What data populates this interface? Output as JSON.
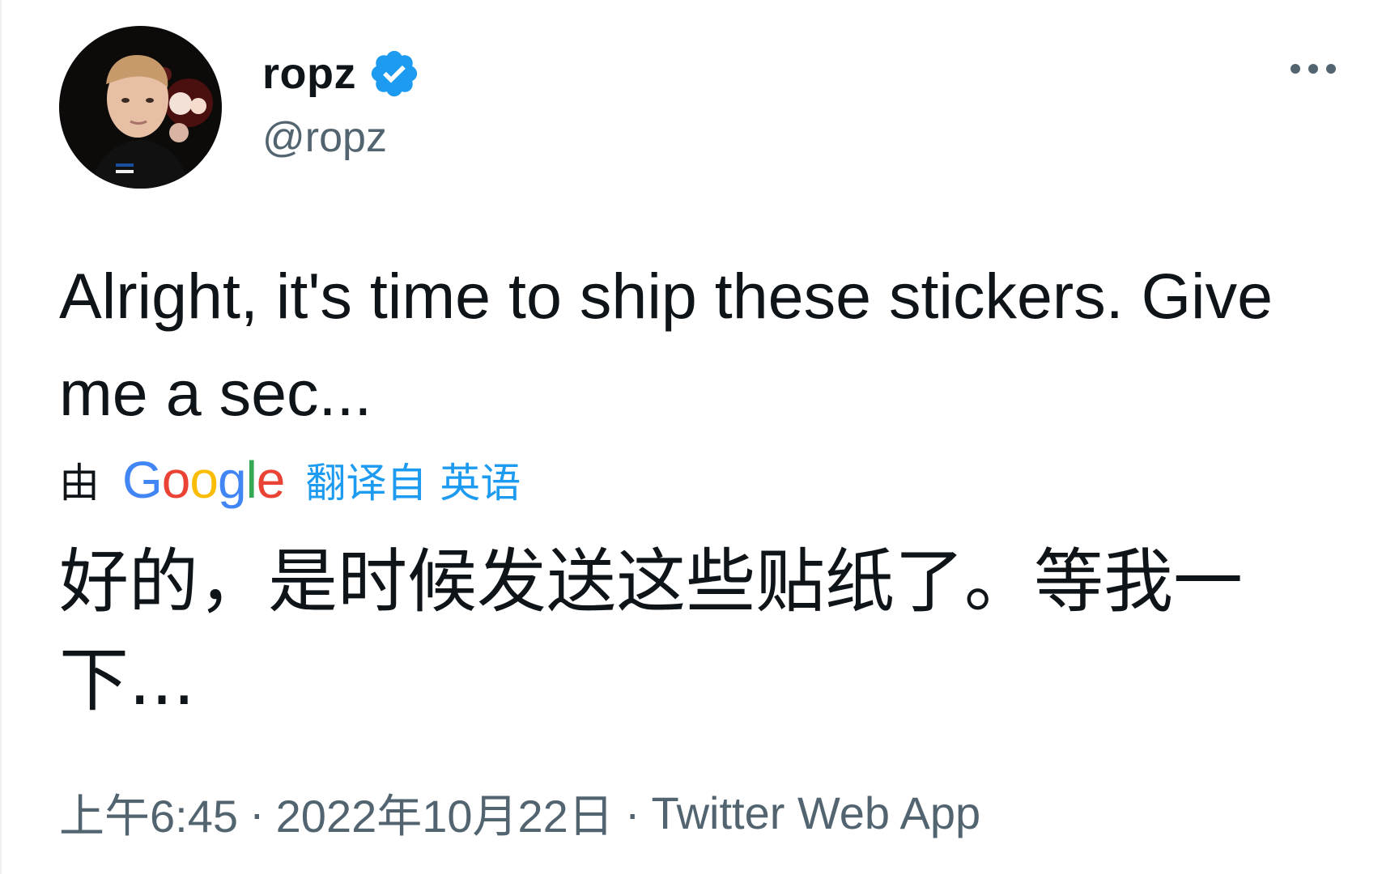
{
  "author": {
    "display_name": "ropz",
    "handle": "@ropz",
    "verified": true,
    "avatar_icon": "avatar-photo"
  },
  "tweet": {
    "text": "Alright, it's time to ship these stickers. Give me a sec...",
    "translation_by_prefix": "由",
    "translation_provider": "Google",
    "translation_label": "翻译自 英语",
    "translated_text": "好的，是时候发送这些贴纸了。等我一下...",
    "time": "上午6:45",
    "date": "2022年10月22日",
    "separator": "·",
    "source": "Twitter Web App"
  },
  "icons": {
    "verified": "verified-badge-icon",
    "more": "more-options-icon"
  },
  "colors": {
    "text_primary": "#0f1419",
    "text_secondary": "#536471",
    "accent": "#1d9bf0"
  }
}
